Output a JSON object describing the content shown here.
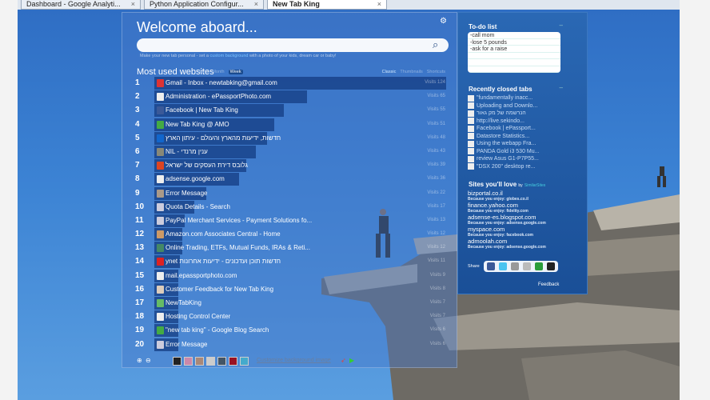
{
  "browser_tabs": [
    {
      "label": "Dashboard - Google Analyti..."
    },
    {
      "label": "Python Application Configur..."
    },
    {
      "label": "New Tab King",
      "active": true
    }
  ],
  "header": {
    "title": "Welcome aboard...",
    "tip_before": "Make your new tab personal - set a ",
    "tip_link": "custom background",
    "tip_after": " with a photo of your kids, dream car or baby!"
  },
  "most_used": {
    "title": "Most used websites",
    "periods": [
      "Ever",
      "Month",
      "Week"
    ],
    "selected_period": "Week",
    "views": [
      "Classic",
      "Thumbnails",
      "Shortcuts"
    ],
    "selected_view": "Classic",
    "items": [
      {
        "rank": "1",
        "title": "Gmail - Inbox - newtabking@gmail.com",
        "visits": "Visits 124",
        "count": 124,
        "color": "#d33"
      },
      {
        "rank": "2",
        "title": "Administration - ePassportPhoto.com",
        "visits": "Visits 65",
        "count": 65,
        "color": "#eee"
      },
      {
        "rank": "3",
        "title": "Facebook | New Tab King",
        "visits": "Visits 55",
        "count": 55,
        "color": "#3b5998"
      },
      {
        "rank": "4",
        "title": "New Tab King @ AMO",
        "visits": "Visits 51",
        "count": 51,
        "color": "#4a4"
      },
      {
        "rank": "5",
        "title": "חדשות, ידיעות מהארץ והעולם - עיתון הארץ",
        "visits": "Visits 48",
        "count": 48,
        "color": "#16c"
      },
      {
        "rank": "6",
        "title": "NIL - ענין מרנדי",
        "visits": "Visits 43",
        "count": 43,
        "color": "#887"
      },
      {
        "rank": "7",
        "title": "גלובס דירת העסקים של ישראל",
        "visits": "Visits 39",
        "count": 39,
        "color": "#d42"
      },
      {
        "rank": "8",
        "title": "adsense.google.com",
        "visits": "Visits 36",
        "count": 36,
        "color": "#eee"
      },
      {
        "rank": "9",
        "title": "Error Message",
        "visits": "Visits 22",
        "count": 22,
        "color": "#a98"
      },
      {
        "rank": "10",
        "title": "Quota Details - Search",
        "visits": "Visits 17",
        "count": 17,
        "color": "#ccd"
      },
      {
        "rank": "11",
        "title": "PayPal Merchant Services - Payment Solutions fo...",
        "visits": "Visits 13",
        "count": 13,
        "color": "#ccd"
      },
      {
        "rank": "12",
        "title": "Amazon.com Associates Central - Home",
        "visits": "Visits 12",
        "count": 12,
        "color": "#c96"
      },
      {
        "rank": "13",
        "title": "Online Trading, ETFs, Mutual Funds, IRAs & Reti...",
        "visits": "Visits 12",
        "count": 12,
        "color": "#486"
      },
      {
        "rank": "14",
        "title": "ynet חדשות תוכן ועדכונים - ידיעות אחרונות",
        "visits": "Visits 11",
        "count": 11,
        "color": "#d22"
      },
      {
        "rank": "15",
        "title": "mail.epassportphoto.com",
        "visits": "Visits 9",
        "count": 9,
        "color": "#eee"
      },
      {
        "rank": "16",
        "title": "Customer Feedback for New Tab King",
        "visits": "Visits 8",
        "count": 8,
        "color": "#dcb"
      },
      {
        "rank": "17",
        "title": "NewTabKing",
        "visits": "Visits 7",
        "count": 7,
        "color": "#6b6"
      },
      {
        "rank": "18",
        "title": "Hosting Control Center",
        "visits": "Visits 7",
        "count": 7,
        "color": "#eee"
      },
      {
        "rank": "19",
        "title": "\"new tab king\" - Google Blog Search",
        "visits": "Visits 6",
        "count": 6,
        "color": "#4a4"
      },
      {
        "rank": "20",
        "title": "Error Message",
        "visits": "Visits 6",
        "count": 6,
        "color": "#ccd"
      }
    ]
  },
  "footer": {
    "customize": "Customize background image",
    "swatches": [
      "#222",
      "#c8a",
      "#a87",
      "#ccc",
      "#456",
      "#912",
      "#4ac"
    ]
  },
  "sidebar": {
    "todo_title": "To-do list",
    "todo_items": [
      "-call mom",
      "-lose 5 pounds",
      "-ask for a raise"
    ],
    "closed_title": "Recently closed tabs",
    "closed": [
      "\"fundamentally inacc...",
      "Uploading and Downlo...",
      "הנרשמה של מק גאור",
      "http://live.sekindo...",
      "Facebook | ePassport...",
      "Datastore Statistics...",
      "Using the webapp Fra...",
      "PANDA Gold i3 530 Mu...",
      "review Asus G1-P7P55...",
      "\"DSX 200\" desktop re..."
    ],
    "sites_title": "Sites you'll love",
    "sites_by": "by",
    "sites_brand": "SimilarSites",
    "sites": [
      {
        "name": "bizportal.co.il",
        "because": "Because you enjoy: globes.co.il"
      },
      {
        "name": "finance.yahoo.com",
        "because": "Because you enjoy: fidelity.com"
      },
      {
        "name": "adsense-es.blogspot.com",
        "because": "Because you enjoy: adsense.google.com"
      },
      {
        "name": "myspace.com",
        "because": "Because you enjoy: facebook.com"
      },
      {
        "name": "admoolah.com",
        "because": "Because you enjoy: adsense.google.com"
      }
    ],
    "share_label": "Share",
    "share_colors": [
      "#3b5998",
      "#4ac3f0",
      "#999",
      "#bbb",
      "#2a9d3a",
      "#222"
    ],
    "feedback": "Feedback"
  }
}
